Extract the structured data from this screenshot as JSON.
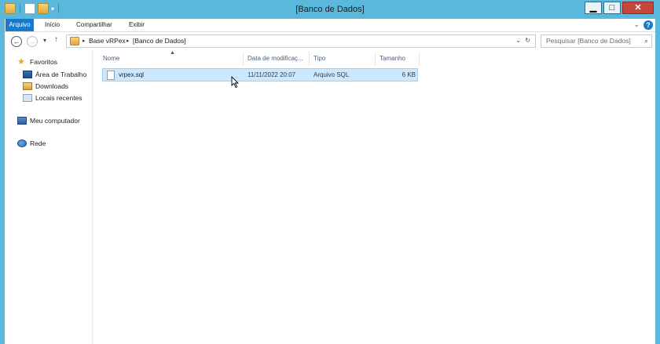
{
  "window": {
    "title": "[Banco de Dados]",
    "minimize_glyph": "▁",
    "maximize_glyph": "□",
    "close_glyph": "✕"
  },
  "qat": {
    "dropdown_glyph": "▾"
  },
  "ribbon": {
    "tabs": [
      "Arquivo",
      "Início",
      "Compartilhar",
      "Exibir"
    ],
    "expand_glyph": "⌄",
    "help_glyph": "?"
  },
  "nav": {
    "back_glyph": "←",
    "forward_glyph": "→",
    "recent_glyph": "▾",
    "up_glyph": "↑",
    "breadcrumbs": [
      "Base vRPex",
      "[Banco de Dados]"
    ],
    "crumb_sep": "▸",
    "address_dropdown": "⌄",
    "refresh_glyph": "↻",
    "search_placeholder": "Pesquisar [Banco de Dados]",
    "search_glyph": "⌕"
  },
  "sidebar": {
    "favorites": "Favoritos",
    "items": [
      {
        "label": "Área de Trabalho",
        "icon": "desktop-icon"
      },
      {
        "label": "Downloads",
        "icon": "downloads-folder-icon"
      },
      {
        "label": "Locais recentes",
        "icon": "recent-places-icon"
      }
    ],
    "computer": "Meu computador",
    "network": "Rede"
  },
  "filelist": {
    "columns": [
      "Nome",
      "Data de modificaç...",
      "Tipo",
      "Tamanho"
    ],
    "sort_glyph": "▲",
    "rows": [
      {
        "name": "vrpex.sql",
        "modified": "11/11/2022 20:07",
        "type": "Arquivo SQL",
        "size": "6 KB",
        "selected": true
      }
    ]
  },
  "colors": {
    "window_frame": "#5ab8dc",
    "file_tab": "#1979ca",
    "selection_fill": "#cce8ff",
    "selection_border": "#99d1ff"
  }
}
